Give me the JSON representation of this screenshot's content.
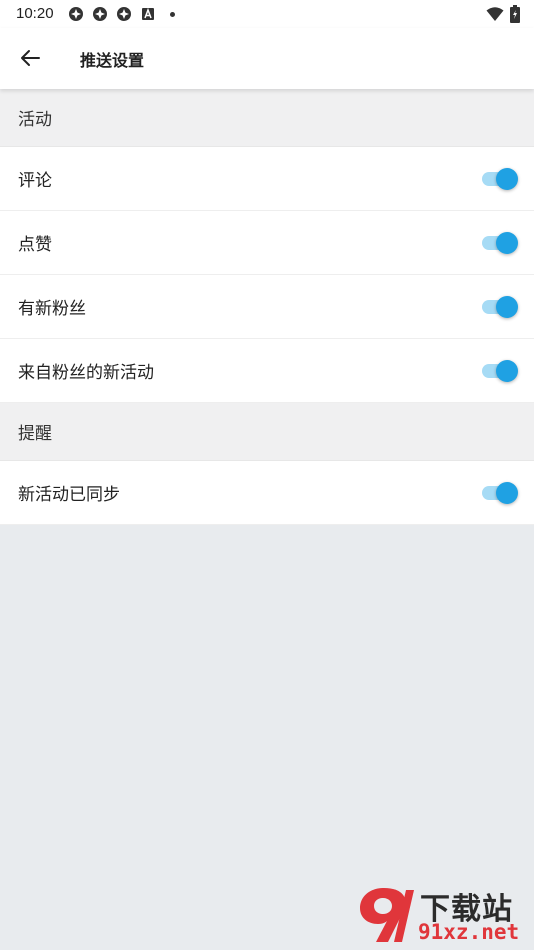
{
  "status_bar": {
    "time": "10:20",
    "left_icons": [
      "app-notification-icon",
      "app-notification-icon",
      "app-notification-icon",
      "a-icon",
      "dot-icon"
    ],
    "right_icons": [
      "wifi-icon",
      "battery-icon"
    ]
  },
  "app_bar": {
    "title": "推送设置"
  },
  "sections": [
    {
      "header": "活动",
      "rows": [
        {
          "label": "评论",
          "on": true
        },
        {
          "label": "点赞",
          "on": true
        },
        {
          "label": "有新粉丝",
          "on": true
        },
        {
          "label": "来自粉丝的新活动",
          "on": true
        }
      ]
    },
    {
      "header": "提醒",
      "rows": [
        {
          "label": "新活动已同步",
          "on": true
        }
      ]
    }
  ],
  "colors": {
    "toggle_on_thumb": "#1fa1e3",
    "toggle_on_track": "#a6dbf5",
    "page_background": "#e8ebee",
    "section_header_background": "#f0f0f1",
    "watermark_red": "#e0363b"
  },
  "watermark": {
    "title": "下载站",
    "domain": "91xz.net"
  }
}
